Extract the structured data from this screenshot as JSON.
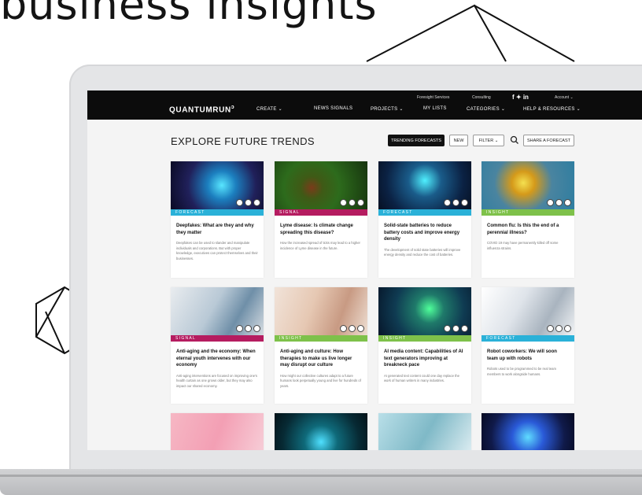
{
  "headline": "business insights",
  "app": {
    "logo": "QUANTUMRUN",
    "top_links": [
      "Foresight Services",
      "Consulting"
    ],
    "account": "Account ⌄",
    "social": "f  ✦  in",
    "nav": [
      "CREATE ⌄",
      "NEWS SIGNALS",
      "PROJECTS ⌄",
      "MY LISTS",
      "CATEGORIES ⌄",
      "HELP & RESOURCES ⌄"
    ]
  },
  "toolbar": {
    "title": "EXPLORE FUTURE TRENDS",
    "trending": "TRENDING FORECASTS",
    "new": "NEW",
    "filter": "FILTER ⌄",
    "share": "SHARE A FORECAST"
  },
  "cards": [
    {
      "tag": "FORECAST",
      "tag_color": "#2ab1d8",
      "title": "Deepfakes: What are they and why they matter",
      "desc": "Deepfakes can be used to slander and manipulate individuals and corporations. But with proper knowledge, executives can protect themselves and their businesses.",
      "img": "img-deepfake"
    },
    {
      "tag": "SIGNAL",
      "tag_color": "#b51c60",
      "title": "Lyme disease: Is climate change spreading this disease?",
      "desc": "How the increased spread of ticks may lead to a higher incidence of Lyme disease in the future.",
      "img": "img-tick"
    },
    {
      "tag": "FORECAST",
      "tag_color": "#2ab1d8",
      "title": "Solid-state batteries to reduce battery costs and improve energy density",
      "desc": "The development of solid state batteries will improve energy density and reduce the cost of batteries.",
      "img": "img-battery"
    },
    {
      "tag": "INSIGHT",
      "tag_color": "#7ec14a",
      "title": "Common flu: Is this the end of a perennial illness?",
      "desc": "COVID 19 may have permanently killed off some influenza strains.",
      "img": "img-flu"
    },
    {
      "tag": "SIGNAL",
      "tag_color": "#b51c60",
      "title": "Anti-aging and the economy: When eternal youth intervenes with our economy",
      "desc": "Anti-aging interventions are focused on improving one's health curtain as one grows older, but they may also impact our shared economy.",
      "img": "img-clinic"
    },
    {
      "tag": "INSIGHT",
      "tag_color": "#7ec14a",
      "title": "Anti-aging and culture: How therapies to make us live longer may disrupt our culture",
      "desc": "How might our collective cultures adapt to a future humans look perpetually young and live for hundreds of years.",
      "img": "img-face"
    },
    {
      "tag": "INSIGHT",
      "tag_color": "#7ec14a",
      "title": "AI media content: Capabilities of AI text generators improving at breakneck pace",
      "desc": "AI generated text content could one day replace the work of human writers in many industries.",
      "img": "img-ai"
    },
    {
      "tag": "FORECAST",
      "tag_color": "#2ab1d8",
      "title": "Robot coworkers: We will soon team up with robots",
      "desc": "Robots used to be programmed to be real team members to work alongside humans.",
      "img": "img-robot"
    },
    {
      "tag": "",
      "tag_color": "#ffffff",
      "title": "",
      "desc": "",
      "img": "img-pink"
    },
    {
      "tag": "",
      "tag_color": "#ffffff",
      "title": "",
      "desc": "",
      "img": "img-tech"
    },
    {
      "tag": "",
      "tag_color": "#ffffff",
      "title": "",
      "desc": "",
      "img": "img-phone"
    },
    {
      "tag": "",
      "tag_color": "#ffffff",
      "title": "",
      "desc": "",
      "img": "img-finger"
    }
  ]
}
